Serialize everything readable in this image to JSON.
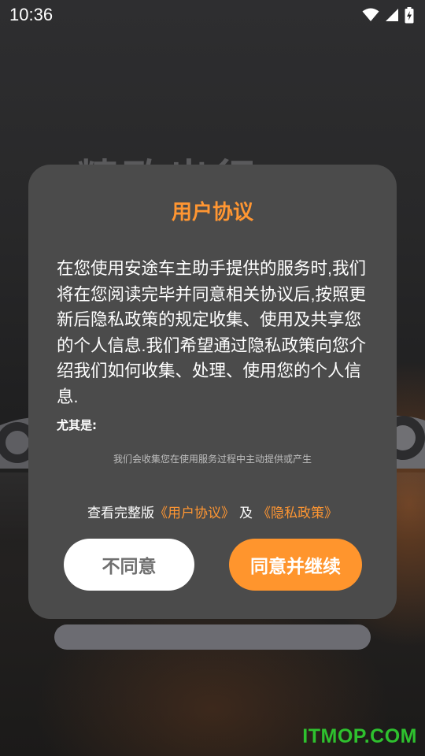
{
  "status_bar": {
    "time": "10:36",
    "icons": [
      "wifi-icon",
      "signal-icon",
      "battery-charging-icon"
    ]
  },
  "background": {
    "slogan": "精致出行"
  },
  "dialog": {
    "title": "用户协议",
    "paragraph": "在您使用安途车主助手提供的服务时,我们将在您阅读完毕并同意相关协议后,按照更新后隐私政策的规定收集、使用及共享您的个人信息.我们希望通过隐私政策向您介绍我们如何收集、处理、使用您的个人信息.",
    "subheading": "尤其是:",
    "cut_line": "我们会收集您在使用服务过程中主动提供或产生",
    "links_prefix": "查看完整版",
    "user_agreement_link": "《用户协议》",
    "links_separator": "及",
    "privacy_policy_link": "《隐私政策》",
    "disagree_label": "不同意",
    "agree_label": "同意并继续"
  },
  "watermark": {
    "text": "ITMOP.COM"
  },
  "colors": {
    "accent": "#ff9632",
    "dialog_bg": "#4b4b4b",
    "watermark": "#2ec12e"
  }
}
